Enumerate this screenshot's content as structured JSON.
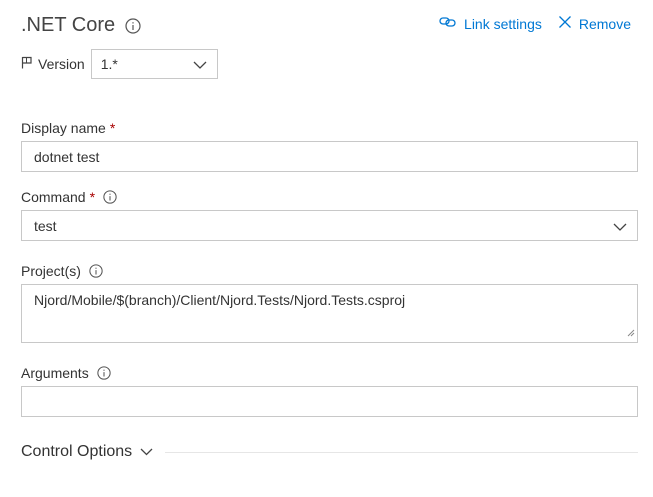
{
  "header": {
    "title": ".NET Core",
    "link_settings": "Link settings",
    "remove": "Remove"
  },
  "version": {
    "label": "Version",
    "value": "1.*"
  },
  "fields": {
    "display_name": {
      "label": "Display name",
      "required_marker": "*",
      "value": "dotnet test"
    },
    "command": {
      "label": "Command",
      "required_marker": "*",
      "value": "test"
    },
    "projects": {
      "label": "Project(s)",
      "value": "Njord/Mobile/$(branch)/Client/Njord.Tests/Njord.Tests.csproj"
    },
    "arguments": {
      "label": "Arguments",
      "value": ""
    }
  },
  "control_options": {
    "label": "Control Options"
  },
  "colors": {
    "accent": "#0078d4",
    "required": "#a80000",
    "border": "#c8c8c8",
    "text": "#333333"
  },
  "icons": [
    "info-icon",
    "link-icon",
    "close-icon",
    "flag-icon",
    "chevron-down-icon",
    "resize-grip-icon"
  ]
}
